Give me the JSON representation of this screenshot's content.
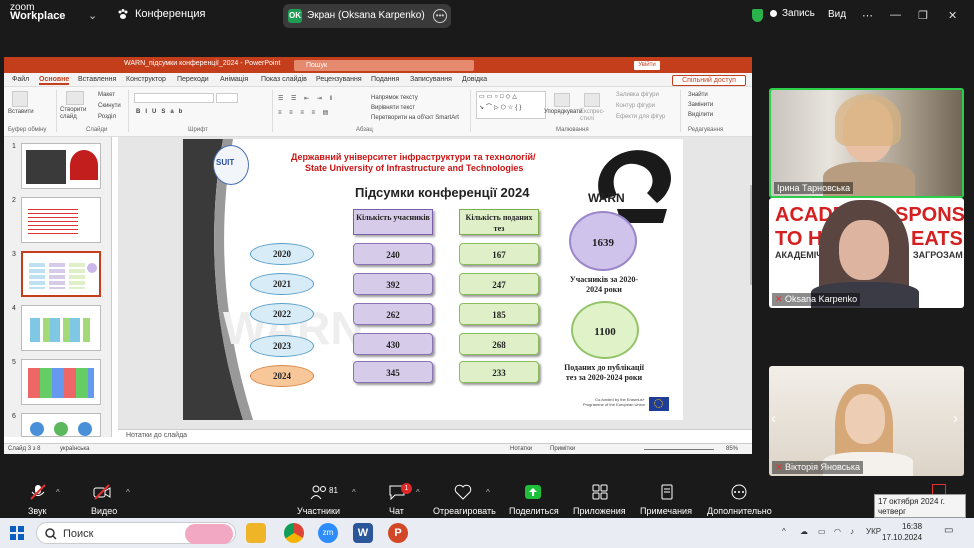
{
  "zoom": {
    "logo_top": "zoom",
    "logo_bottom": "Workplace",
    "meeting_label": "Конференция",
    "share_status": "Экран (Oksana Karpenko)",
    "ok_badge": "OK",
    "record_label": "Запись",
    "view_label": "Вид"
  },
  "ppt": {
    "title": "WARN_підсумки конференції_2024  -  PowerPoint",
    "search_placeholder": "Пошук",
    "login_label": "Увійти",
    "share_label": "Спільний доступ",
    "menu": [
      "Файл",
      "Основне",
      "Вставлення",
      "Конструктор",
      "Переходи",
      "Анімація",
      "Показ слайдів",
      "Рецензування",
      "Подання",
      "Записування",
      "Довідка"
    ],
    "ribbon": {
      "paste": "Вставити",
      "create_slide": "Створити слайд",
      "layout": "Макет",
      "reset": "Скинути",
      "section": "Розділ",
      "clipboard": "Буфер обміну",
      "slides": "Слайди",
      "font": "Шрифт",
      "paragraph": "Абзац",
      "text_direction": "Напрямок тексту",
      "align_text": "Вирівняти текст",
      "smartart": "Перетворити на об'єкт SmartArt",
      "arrange": "Упорядкувати",
      "quick_styles": "Експрес-стилі",
      "fill": "Заливка фігури",
      "outline": "Контур фігури",
      "effects": "Ефекти для фігур",
      "drawing": "Малювання",
      "find": "Знайти",
      "replace": "Замінити",
      "select": "Виділити",
      "editing": "Редагування"
    },
    "slide_numbers": [
      "1",
      "2",
      "3",
      "4",
      "5",
      "6"
    ],
    "notes_placeholder": "Нотатки до слайда",
    "status": {
      "slide": "Слайд 3 з 8",
      "lang": "українська",
      "notes": "Нотатки",
      "comments": "Примітки",
      "zoom": "85%"
    }
  },
  "slide": {
    "uni_line1": "Державний університет інфраструктури та технологій/",
    "uni_line2": "State University of Infrastructure and Technologies",
    "title": "Підсумки конференції 2024",
    "col1_header": "Кількість учасників",
    "col2_header": "Кількість поданих тез",
    "years": [
      "2020",
      "2021",
      "2022",
      "2023",
      "2024"
    ],
    "participants": [
      "240",
      "392",
      "262",
      "430",
      "345"
    ],
    "theses": [
      "167",
      "247",
      "185",
      "268",
      "233"
    ],
    "total_participants": "1639",
    "total_participants_caption": "Учасників за 2020-2024 роки",
    "total_theses": "1100",
    "total_theses_caption": "Поданих до публікації тез за 2020-2024 роки",
    "warn_logo": "WARN",
    "suit_logo": "SUIT",
    "eu_text": "Co-funded by the Erasmus+ Programme of the European Union"
  },
  "participants": [
    {
      "name": "Ірина Тарновська",
      "bg": "#8a7f72"
    },
    {
      "name": "Oksana Karpenko",
      "bg": "#5a4540",
      "banner1": "ACADE",
      "banner2": "SPONSE",
      "banner3": "TO H",
      "banner4": "EATS",
      "banner5": "АКАДЕМІЧН",
      "banner6": "ЗАГРОЗАМ"
    },
    {
      "name": "Вікторія Яновська",
      "bg": "#d8d0c8"
    }
  ],
  "toolbar": {
    "audio": "Звук",
    "video": "Видео",
    "participants": "Участники",
    "participants_count": "81",
    "chat": "Чат",
    "chat_badge": "1",
    "react": "Отреагировать",
    "share": "Поделиться",
    "apps": "Приложения",
    "notes": "Примечания",
    "more": "Дополнительно"
  },
  "tooltip": {
    "line1": "17 октября 2024 г.",
    "line2": "четверг"
  },
  "taskbar": {
    "search": "Поиск",
    "time": "16:38",
    "date": "17.10.2024",
    "lang": "УКР"
  },
  "colors": {
    "ppt_red": "#c43e1c",
    "zoom_bg": "#1a1a1a",
    "share_green": "#1f9d55"
  }
}
